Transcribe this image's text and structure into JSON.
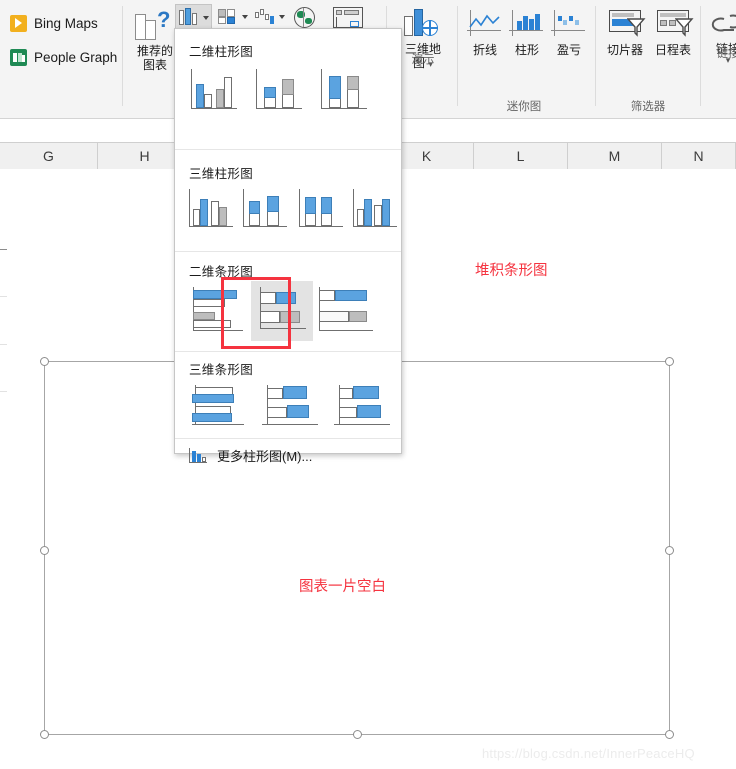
{
  "ribbon": {
    "addins": [
      {
        "name": "bing-maps",
        "label": "Bing Maps",
        "color": "#f2b01e"
      },
      {
        "name": "people-graph",
        "label": "People Graph",
        "color": "#1f8a54"
      }
    ],
    "recommended_charts": {
      "label_line1": "推荐的",
      "label_line2": "图表",
      "icon": "recommended-charts-icon"
    },
    "chart_buttons": [
      {
        "name": "column-chart-button",
        "icon": "column-chart-icon",
        "active": true
      },
      {
        "name": "hierarchy-chart-button",
        "icon": "hierarchy-chart-icon",
        "active": false
      },
      {
        "name": "waterfall-chart-button",
        "icon": "waterfall-chart-icon",
        "active": false
      },
      {
        "name": "map-chart-button",
        "icon": "globe-map-icon",
        "active": false
      },
      {
        "name": "pivot-chart-button",
        "icon": "pivot-chart-icon",
        "active": false
      }
    ],
    "tours": {
      "label_line1": "三维地",
      "label_line2": "图",
      "group": "演示",
      "icon": "3d-map-icon"
    },
    "sparklines": {
      "group": "迷你图",
      "items": [
        {
          "name": "line-sparkline",
          "label": "折线",
          "icon": "line-sparkline-icon"
        },
        {
          "name": "column-sparkline",
          "label": "柱形",
          "icon": "column-sparkline-icon"
        },
        {
          "name": "winloss-sparkline",
          "label": "盈亏",
          "icon": "winloss-sparkline-icon"
        }
      ]
    },
    "filters": {
      "group": "筛选器",
      "items": [
        {
          "name": "slicer",
          "label": "切片器",
          "icon": "slicer-icon"
        },
        {
          "name": "timeline",
          "label": "日程表",
          "icon": "timeline-icon"
        }
      ]
    },
    "links": {
      "group": "链接",
      "label": "链接",
      "icon": "link-icon"
    }
  },
  "grid": {
    "columns": [
      "G",
      "H",
      "K",
      "L",
      "M",
      "N"
    ]
  },
  "dropdown": {
    "sections": [
      {
        "name": "2d-column",
        "title": "二维柱形图",
        "count": 3
      },
      {
        "name": "3d-column",
        "title": "三维柱形图",
        "count": 4
      },
      {
        "name": "2d-bar",
        "title": "二维条形图",
        "count": 3
      },
      {
        "name": "3d-bar",
        "title": "三维条形图",
        "count": 3
      }
    ],
    "more_item": {
      "label": "更多柱形图(M)...",
      "icon": "more-charts-icon"
    },
    "annotation": {
      "text": "堆积条形图",
      "color": "#f5333f"
    },
    "highlighted_thumb": {
      "section": "2d-bar",
      "index": 1,
      "name": "stacked-bar-thumb"
    }
  },
  "canvas": {
    "blank_note": "图表一片空白",
    "note_color": "#f5333f",
    "watermark": "https://blog.csdn.net/InnerPeaceHQ"
  }
}
